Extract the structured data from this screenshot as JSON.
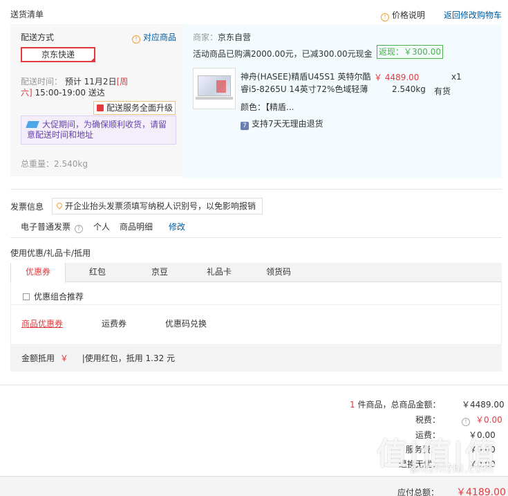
{
  "header": {
    "title": "送货清单",
    "price_explain": "价格说明",
    "back_to_cart": "返回修改购物车"
  },
  "delivery": {
    "method_label": "配送方式",
    "match_goods": "对应商品",
    "method_value": "京东快递",
    "time_label": "配送时间：",
    "time_pre": "预计 11月2日",
    "time_weekday_a": "[周",
    "time_weekday_b": "六]",
    "time_range": "15:00-19:00 送达",
    "upgrade": "配送服务全面升级",
    "notice": "大促期间，为确保顺利收货，请留意配送时间和地址",
    "weight_label": "总重量：",
    "weight_value": "2.540kg"
  },
  "goods": {
    "seller_label": "商家：",
    "seller_value": "京东自营",
    "promo": "活动商品已购满2000.00元，已减300.00元现金",
    "cashback": "返现：￥300.00",
    "name_line1": "神舟(HASEE)精盾U45S1 英特尔酷",
    "name_line2": "睿i5-8265U 14英寸72%色域轻薄",
    "color": "颜色：【精盾...",
    "price": "￥ 4489.00",
    "qty": "x1",
    "weight": "2.540kg",
    "stock": "有货",
    "return_policy": "支持7天无理由退货"
  },
  "invoice": {
    "label": "发票信息",
    "tip": "开企业抬头发票须填写纳税人识别号，以免影响报销",
    "type": "电子普通发票",
    "title": "个人",
    "content": "商品明细",
    "edit": "修改"
  },
  "discount": {
    "label": "使用优惠/礼品卡/抵用",
    "tabs": [
      "优惠券",
      "红包",
      "京豆",
      "礼品卡",
      "领货码"
    ],
    "combo": "优惠组合推荐",
    "subtabs": [
      "商品优惠券",
      "运费券",
      "优惠码兑换"
    ],
    "amount_label": "金额抵用",
    "amount_currency": "￥",
    "redpacket": "|使用红包，抵用 1.32 元"
  },
  "summary": {
    "count": "1",
    "count_text": "件商品，总商品金额：",
    "goods_amount": "￥4489.00",
    "tax_label": "税费：",
    "tax_value": "￥0.00",
    "freight_label": "运费：",
    "freight_value": "￥0.00",
    "row4_label": "服务费：",
    "row4_value": "￥0.00",
    "row5_label": "退换无忧：",
    "row5_value": "￥0.00",
    "total_label": "应付总额：",
    "total_value": "￥4189.00"
  },
  "watermark": {
    "logo": "值|值|值",
    "url": "zhizhizhi.com"
  }
}
